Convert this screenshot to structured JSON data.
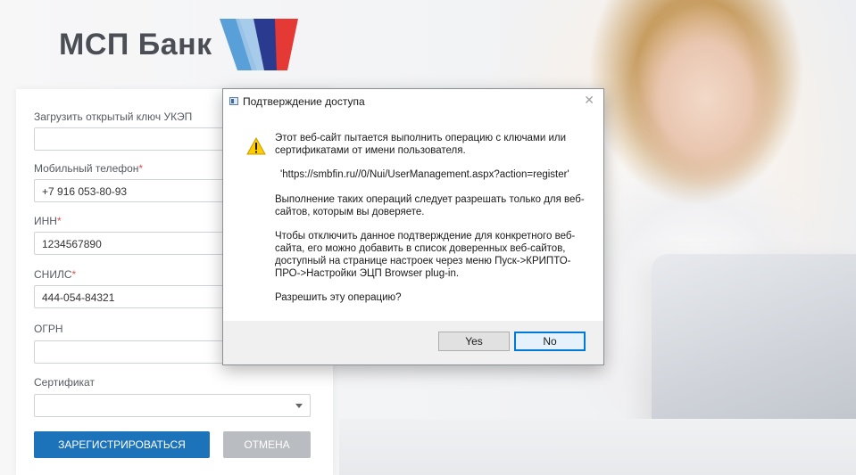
{
  "brand": {
    "logo_text": "МСП Банк",
    "colors": {
      "blue": "#5aa0d8",
      "navy": "#2a3b8f",
      "red": "#e53935",
      "text": "#4b4f55"
    }
  },
  "form": {
    "fields": [
      {
        "label": "Загрузить открытый ключ УКЭП",
        "required": false,
        "value": ""
      },
      {
        "label": "Мобильный телефон",
        "required": true,
        "value": "+7 916 053-80-93"
      },
      {
        "label": "ИНН",
        "required": true,
        "value": "1234567890"
      },
      {
        "label": "СНИЛС",
        "required": true,
        "value": "444-054-84321"
      },
      {
        "label": "ОГРН",
        "required": false,
        "value": ""
      },
      {
        "label": "Сертификат",
        "required": false,
        "value": "",
        "icon": "chevron-down-icon"
      }
    ],
    "required_mark": "*",
    "register_label": "ЗАРЕГИСТРИРОВАТЬСЯ",
    "cancel_label": "ОТМЕНА",
    "colors": {
      "primary": "#1d73b9",
      "cancel": "#b9bcc0",
      "required": "#d9534f"
    }
  },
  "dialog": {
    "title": "Подтверждение доступа",
    "close_symbol": "✕",
    "icon": "warning-icon",
    "paragraphs": [
      "Этот веб-сайт пытается выполнить операцию с ключами или сертификатами от имени пользователя.",
      "'https://smbfin.ru//0/Nui/UserManagement.aspx?action=register'",
      "Выполнение таких операций следует разрешать только для веб-сайтов, которым вы доверяете.",
      "Чтобы отключить данное подтверждение для конкретного веб-сайта, его можно добавить в список доверенных веб-сайтов, доступный на странице настроек через меню Пуск->КРИПТО-ПРО->Настройки ЭЦП Browser plug-in.",
      "Разрешить эту операцию?"
    ],
    "yes_label": "Yes",
    "no_label": "No",
    "colors": {
      "focus": "#0078d7",
      "footer": "#f0f0f0"
    }
  }
}
